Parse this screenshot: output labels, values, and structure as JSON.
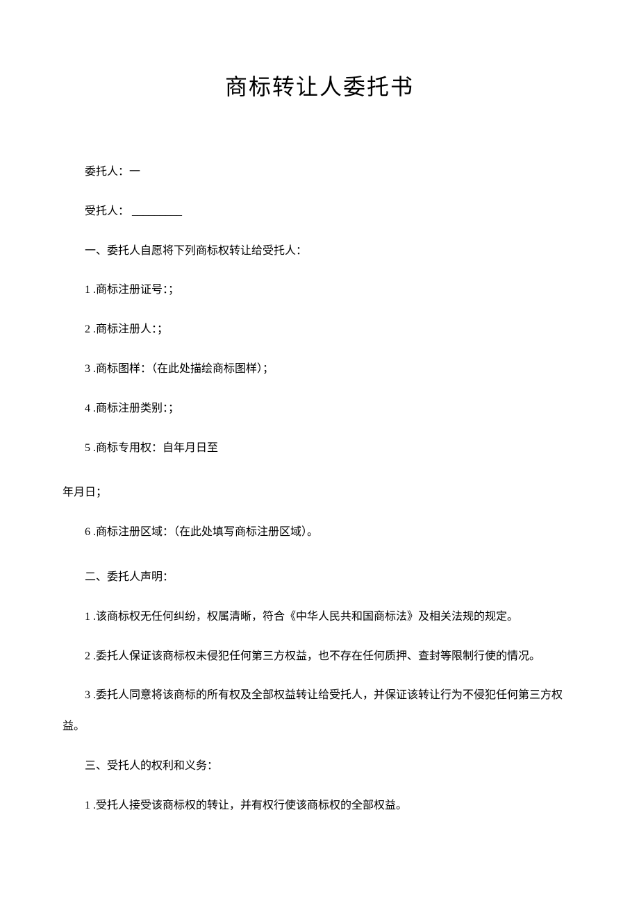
{
  "title": "商标转让人委托书",
  "entrustor_label": "委托人：一",
  "trustee_label": "受托人：",
  "trustee_blank": "_________",
  "section1": {
    "heading": "一、委托人自愿将下列商标权转让给受托人：",
    "item1": "1 .商标注册证号：；",
    "item2": "2 .商标注册人：；",
    "item3": "3 .商标图样：（在此处描绘商标图样）；",
    "item4": "4 .商标注册类别：；",
    "item5": "5 .商标专用权：自年月日至",
    "item5_cont": "年月日；",
    "item6": "6 .商标注册区域：（在此处填写商标注册区域）。"
  },
  "section2": {
    "heading": "二、委托人声明：",
    "item1": "1 .该商标权无任何纠纷，权属清晰，符合《中华人民共和国商标法》及相关法规的规定。",
    "item2": "2 .委托人保证该商标权未侵犯任何第三方权益，也不存在任何质押、查封等限制行使的情况。",
    "item3": "3 .委托人同意将该商标的所有权及全部权益转让给受托人，并保证该转让行为不侵犯任何第三方权益。"
  },
  "section3": {
    "heading": "三、受托人的权利和义务：",
    "item1": "1 .受托人接受该商标权的转让，并有权行使该商标权的全部权益。"
  }
}
